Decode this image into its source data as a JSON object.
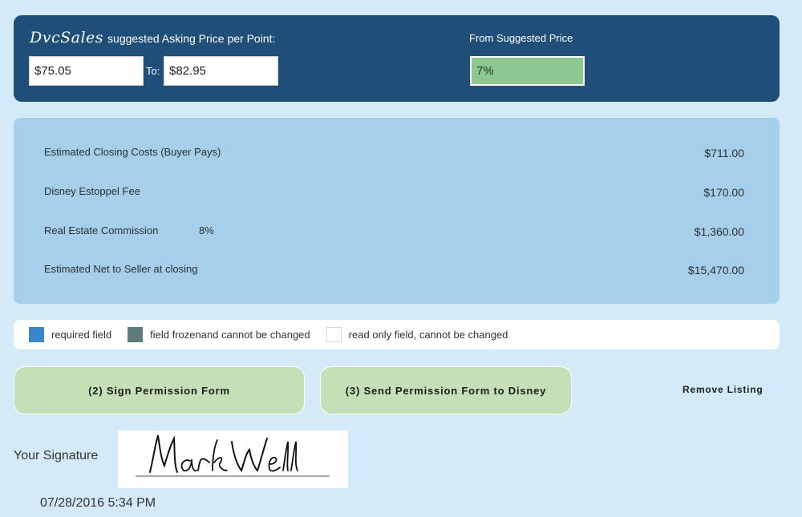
{
  "price_panel": {
    "brand": "DvcSales",
    "asking_label": "suggested Asking Price per Point:",
    "from_value": "$75.05",
    "to_label": "To:",
    "to_value": "$82.95",
    "from_suggested_label": "From Suggested Price",
    "from_suggested_value": "7%",
    "accent_color": "#1f4e79",
    "pct_box_color": "#8dc891"
  },
  "summary": {
    "rows": [
      {
        "label": "Estimated Closing Costs (Buyer Pays)",
        "pct": "",
        "value": "$711.00"
      },
      {
        "label": "Disney Estoppel Fee",
        "pct": "",
        "value": "$170.00"
      },
      {
        "label": "Real Estate Commission",
        "pct": "8%",
        "value": "$1,360.00"
      },
      {
        "label": "Estimated Net to Seller at closing",
        "pct": "",
        "value": "$15,470.00"
      }
    ]
  },
  "legend": {
    "required": "required field",
    "frozen": "field frozenand cannot be changed",
    "readonly": "read only field, cannot be changed",
    "required_color": "#3a86c8",
    "frozen_color": "#5e7b7b"
  },
  "actions": {
    "sign": "(2) Sign Permission Form",
    "send": "(3) Send Permission Form to Disney",
    "remove": "Remove Listing"
  },
  "signature": {
    "label": "Your Signature",
    "date": "07/28/2016 5:34 PM",
    "signature_text": "Mark Well"
  }
}
